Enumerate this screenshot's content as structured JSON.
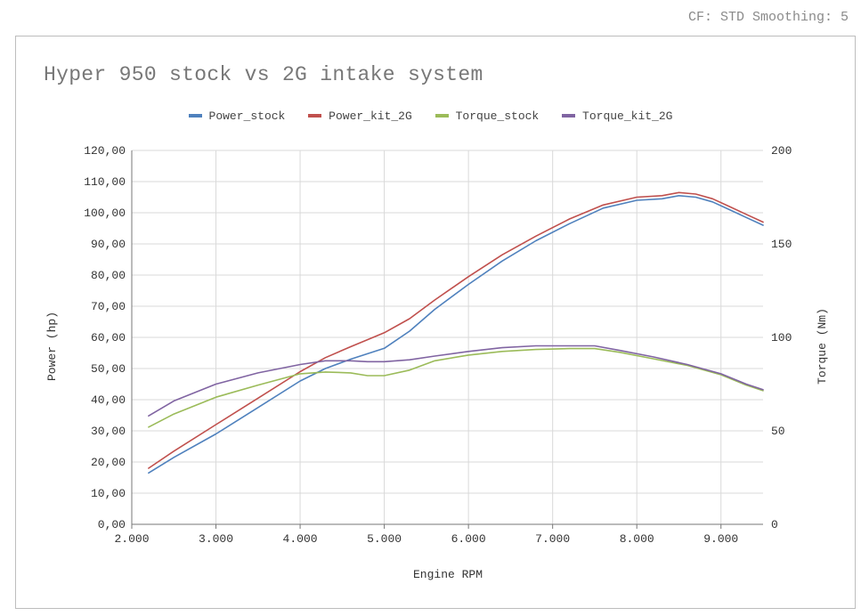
{
  "header_note": "CF: STD Smoothing: 5",
  "chart_data": {
    "type": "line",
    "title": "Hyper 950 stock vs 2G intake system",
    "xlabel": "Engine RPM",
    "ylabel": "Power (hp)",
    "y2label": "Torque (Nm)",
    "xlim": [
      2000,
      9500
    ],
    "ylim": [
      0,
      120
    ],
    "y2lim": [
      0,
      200
    ],
    "x_ticks": [
      "2.000",
      "3.000",
      "4.000",
      "5.000",
      "6.000",
      "7.000",
      "8.000",
      "9.000"
    ],
    "y_ticks": [
      "0,00",
      "10,00",
      "20,00",
      "30,00",
      "40,00",
      "50,00",
      "60,00",
      "70,00",
      "80,00",
      "90,00",
      "100,00",
      "110,00",
      "120,00"
    ],
    "y2_ticks": [
      "0",
      "50",
      "100",
      "150",
      "200"
    ],
    "grid": true,
    "legend_position": "top-center",
    "series": [
      {
        "name": "Power_stock",
        "axis": "left",
        "color": "#4f81bd",
        "x": [
          2200,
          2500,
          3000,
          3500,
          4000,
          4300,
          4600,
          5000,
          5300,
          5600,
          6000,
          6400,
          6800,
          7200,
          7600,
          8000,
          8300,
          8500,
          8700,
          8900,
          9100,
          9300,
          9500
        ],
        "y": [
          16.5,
          21.5,
          29,
          37.5,
          46,
          50,
          53,
          56.5,
          62,
          69,
          77,
          84.5,
          91,
          96.5,
          101.5,
          104,
          104.5,
          105.5,
          105,
          103.5,
          101,
          98.5,
          96
        ]
      },
      {
        "name": "Power_kit_2G",
        "axis": "left",
        "color": "#c0504d",
        "x": [
          2200,
          2500,
          3000,
          3500,
          4000,
          4300,
          4600,
          5000,
          5300,
          5600,
          6000,
          6400,
          6800,
          7200,
          7600,
          8000,
          8300,
          8500,
          8700,
          8900,
          9100,
          9300,
          9500
        ],
        "y": [
          18,
          23.5,
          32,
          40.5,
          49,
          53.5,
          57,
          61.5,
          66,
          72,
          79.5,
          86.5,
          92.5,
          98,
          102.5,
          105,
          105.5,
          106.5,
          106,
          104.5,
          102,
          99.5,
          97
        ]
      },
      {
        "name": "Torque_stock",
        "axis": "right",
        "color": "#9bbb59",
        "x": [
          2200,
          2500,
          3000,
          3500,
          4000,
          4300,
          4600,
          4800,
          5000,
          5300,
          5600,
          6000,
          6400,
          6800,
          7200,
          7500,
          7800,
          8200,
          8600,
          9000,
          9300,
          9500
        ],
        "y": [
          52,
          59,
          68,
          74.5,
          80.5,
          81.5,
          81,
          79.5,
          79.5,
          82.5,
          87.5,
          90.5,
          92.5,
          93.5,
          94,
          94,
          92,
          88.5,
          85,
          80,
          74.5,
          71.5
        ]
      },
      {
        "name": "Torque_kit_2G",
        "axis": "right",
        "color": "#8064a2",
        "x": [
          2200,
          2500,
          3000,
          3500,
          4000,
          4300,
          4600,
          4800,
          5000,
          5300,
          5600,
          6000,
          6400,
          6800,
          7200,
          7500,
          7800,
          8200,
          8600,
          9000,
          9300,
          9500
        ],
        "y": [
          58,
          66,
          75,
          81,
          85.5,
          87.5,
          87.5,
          87,
          87,
          88,
          90,
          92.5,
          94.5,
          95.5,
          95.5,
          95.5,
          93,
          89.5,
          85.5,
          80.5,
          75,
          72
        ]
      }
    ]
  }
}
